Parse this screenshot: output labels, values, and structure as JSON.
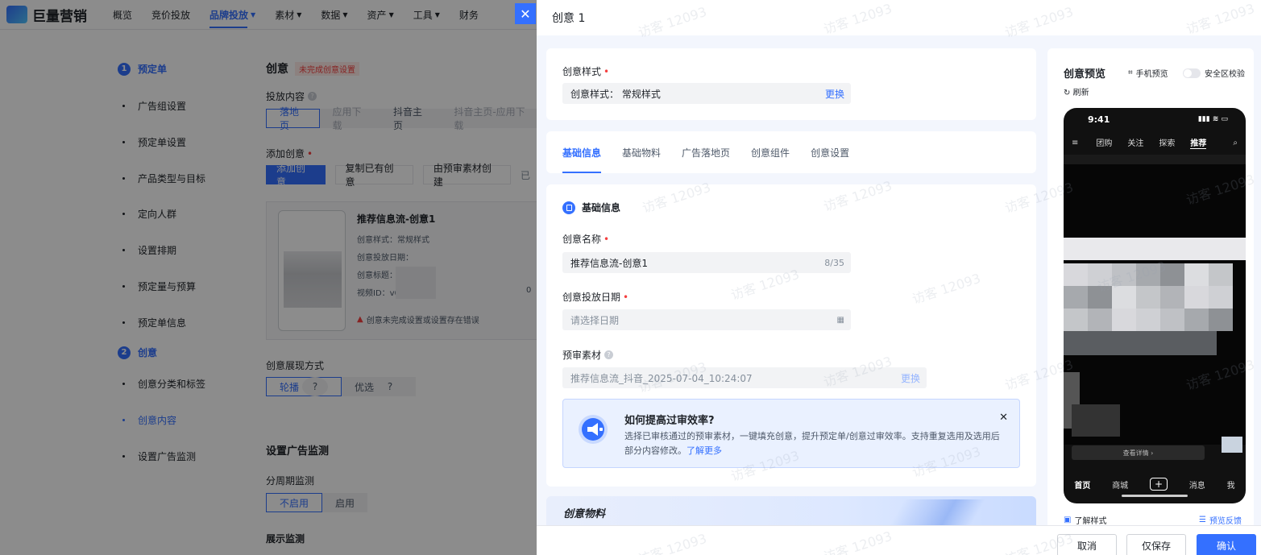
{
  "app": {
    "logo_text": "巨量营销",
    "nav": [
      "概览",
      "竞价投放",
      "品牌投放",
      "素材",
      "数据",
      "资产",
      "工具",
      "财务"
    ],
    "nav_active": 2,
    "nav_has_caret": [
      false,
      false,
      true,
      true,
      true,
      true,
      true,
      false
    ]
  },
  "sidebar": {
    "step1": {
      "num": "1",
      "label": "预定单"
    },
    "step1_items": [
      "广告组设置",
      "预定单设置",
      "产品类型与目标",
      "定向人群",
      "设置排期",
      "预定量与预算",
      "预定单信息"
    ],
    "step2": {
      "num": "2",
      "label": "创意"
    },
    "step2_items": [
      "创意分类和标签",
      "创意内容",
      "设置广告监测"
    ],
    "active_item": "创意内容"
  },
  "main": {
    "title": "创意",
    "title_tag": "未完成创意设置",
    "content_label": "投放内容",
    "content_options": [
      "落地页",
      "应用下载",
      "抖音主页",
      "抖音主页-应用下载"
    ],
    "add_label": "添加创意",
    "add_buttons": [
      "添加创意",
      "复制已有创意",
      "由预审素材创建",
      "已"
    ],
    "card": {
      "title": "推荐信息流-创意1",
      "lines": [
        "创意样式：常规样式",
        "创意投放日期：",
        "创意标题：",
        "视频ID：v0"
      ],
      "video_id_tail": "0",
      "warning": "创意未完成设置或设置存在错误"
    },
    "display_label": "创意展现方式",
    "display_options": [
      "轮播",
      "优选"
    ],
    "monitor_title": "设置广告监测",
    "period_label": "分周期监测",
    "period_options": [
      "不启用",
      "启用"
    ],
    "show_monitor_label": "展示监测"
  },
  "drawer": {
    "title": "创意 1",
    "style_section": {
      "label": "创意样式",
      "field_prefix": "创意样式：",
      "field_value": "常规样式",
      "change": "更换"
    },
    "tabs": [
      "基础信息",
      "基础物料",
      "广告落地页",
      "创意组件",
      "创意设置"
    ],
    "active_tab": 0,
    "basic": {
      "heading": "基础信息",
      "name_label": "创意名称",
      "name_value": "推荐信息流-创意1",
      "name_count": "8/35",
      "date_label": "创意投放日期",
      "date_placeholder": "请选择日期",
      "material_label": "预审素材",
      "material_value": "推荐信息流_抖音_2025-07-04_10:24:07",
      "material_change": "更换"
    },
    "tip": {
      "title": "如何提高过审效率?",
      "text": "选择已审核通过的预审素材，一键填充创意，提升预定单/创意过审效率。支持重复选用及选用后部分内容修改。",
      "link": "了解更多"
    },
    "materials_title": "创意物料",
    "footer": {
      "cancel": "取消",
      "save_only": "仅保存",
      "confirm": "确认"
    }
  },
  "preview": {
    "title": "创意预览",
    "mobile_preview": "手机预览",
    "safe_check": "安全区校验",
    "refresh": "刷新",
    "phone": {
      "time": "9:41",
      "tabs": [
        "团购",
        "关注",
        "探索",
        "推荐"
      ],
      "active_tab": "推荐",
      "detail": "查看详情 ›",
      "nav": [
        "首页",
        "商城",
        "+",
        "消息",
        "我"
      ]
    },
    "learn_style": "了解样式",
    "feedback": "预览反馈"
  },
  "watermark": {
    "text": "访客 12093",
    "id": "16884762209​23803"
  },
  "colors": {
    "accent": "#3470ff",
    "danger": "#f53f3f",
    "drawer_bg": "#f3f6fd"
  }
}
